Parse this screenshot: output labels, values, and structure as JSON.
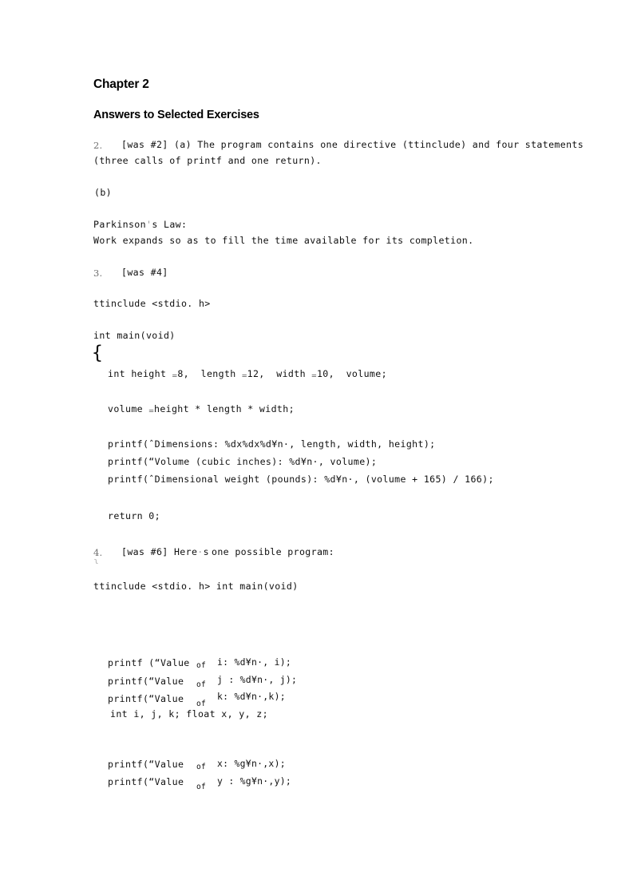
{
  "document": {
    "chapter_title": "Chapter 2",
    "section_title": "Answers to Selected Exercises"
  },
  "items": [
    {
      "marker": "2.",
      "lines": [
        "[was #2] (a) The program contains one directive (ttinclude) and four statements",
        "(three calls of printf and one return)."
      ],
      "part_b_label": "(b)",
      "quote_title": "Parkinson",
      "quote_title_rest": "s Law:",
      "quote_body": "Work expands so as to fill the time available for its completion."
    },
    {
      "marker": "3.",
      "label": "[was #4]",
      "code": {
        "include": "ttinclude <stdio. h>",
        "main_signature": "int main(void)",
        "open_brace": "{",
        "decl_pre": "int height ",
        "decl_eq1": "=",
        "decl_mid1": "8,  length ",
        "decl_eq2": "=",
        "decl_mid2": "12,  width ",
        "decl_eq3": "=",
        "decl_tail": "10,  volume;",
        "assign_pre": "volume ",
        "assign_eq": "=",
        "assign_tail": "height * length * width;",
        "printf_dimensions": "printf(ˆDimensions: %dx%dx%d¥n·, length, width, height);",
        "printf_volume": "printf(“Volume (cubic inches): %d¥n·, volume);",
        "printf_weight": "printf(ˆDimensional weight (pounds): %d¥n·, (volume + 165) / 166);",
        "return_stmt": "return 0;"
      }
    },
    {
      "marker": "4.",
      "label_pre": "[was #6] Here",
      "label_apostrophe": "·",
      "label_mid": "s",
      "label_tail": "one possible program:",
      "stray_glyph": "}",
      "include_line": "ttinclude <stdio. h> int main(void)",
      "printf_rows": [
        {
          "head": "printf (“Value",
          "of": "of",
          "tail": "i: %d¥n·, i);"
        },
        {
          "head": "printf(“Value",
          "of": "of",
          "tail": "j : %d¥n·, j);"
        },
        {
          "head": "printf(“Value",
          "of": "of",
          "tail": "k: %d¥n·,k);"
        }
      ],
      "decl_line": "int i, j, k; float x, y, z;",
      "printf_rows_2": [
        {
          "head": "printf(“Value",
          "of": "of",
          "tail": "x: %g¥n·,x);"
        },
        {
          "head": "printf(“Value",
          "of": "of",
          "tail": "y : %g¥n·,y);"
        }
      ]
    }
  ]
}
